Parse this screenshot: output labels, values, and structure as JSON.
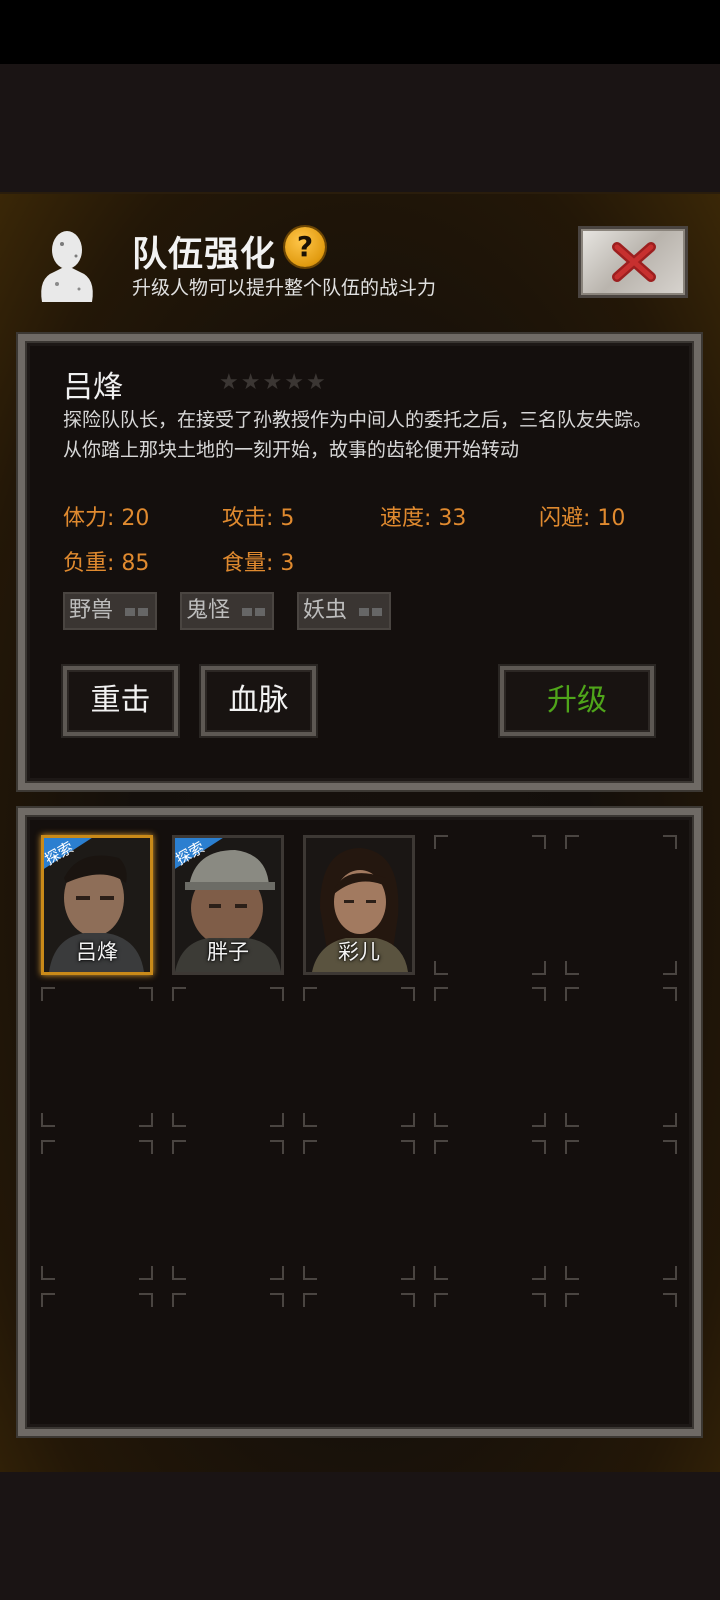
{
  "header": {
    "title": "队伍强化",
    "help_label": "?",
    "subtitle": "升级人物可以提升整个队伍的战斗力"
  },
  "hero": {
    "name": "吕烽",
    "star_rating": 0,
    "star_max": 5,
    "description": "探险队队长，在接受了孙教授作为中间人的委托之后，三名队友失踪。从你踏上那块土地的一刻开始，故事的齿轮便开始转动",
    "stats": [
      {
        "label": "体力: 20"
      },
      {
        "label": "攻击: 5"
      },
      {
        "label": "速度: 33"
      },
      {
        "label": "闪避: 10"
      },
      {
        "label": "负重: 85"
      },
      {
        "label": "食量: 3"
      }
    ],
    "resistances": [
      "野兽",
      "鬼怪",
      "妖虫"
    ]
  },
  "actions": {
    "skill1": "重击",
    "skill2": "血脉",
    "upgrade": "升级"
  },
  "team": {
    "members": [
      {
        "name": "吕烽",
        "badge": "探索",
        "selected": true
      },
      {
        "name": "胖子",
        "badge": "探索",
        "selected": false
      },
      {
        "name": "彩儿",
        "badge": "",
        "selected": false
      }
    ]
  },
  "colors": {
    "stat_text": "#e08a2f",
    "upgrade_text": "#4fa51a",
    "selected_border": "#c98a19",
    "badge_blue": "#2b7fd0"
  }
}
